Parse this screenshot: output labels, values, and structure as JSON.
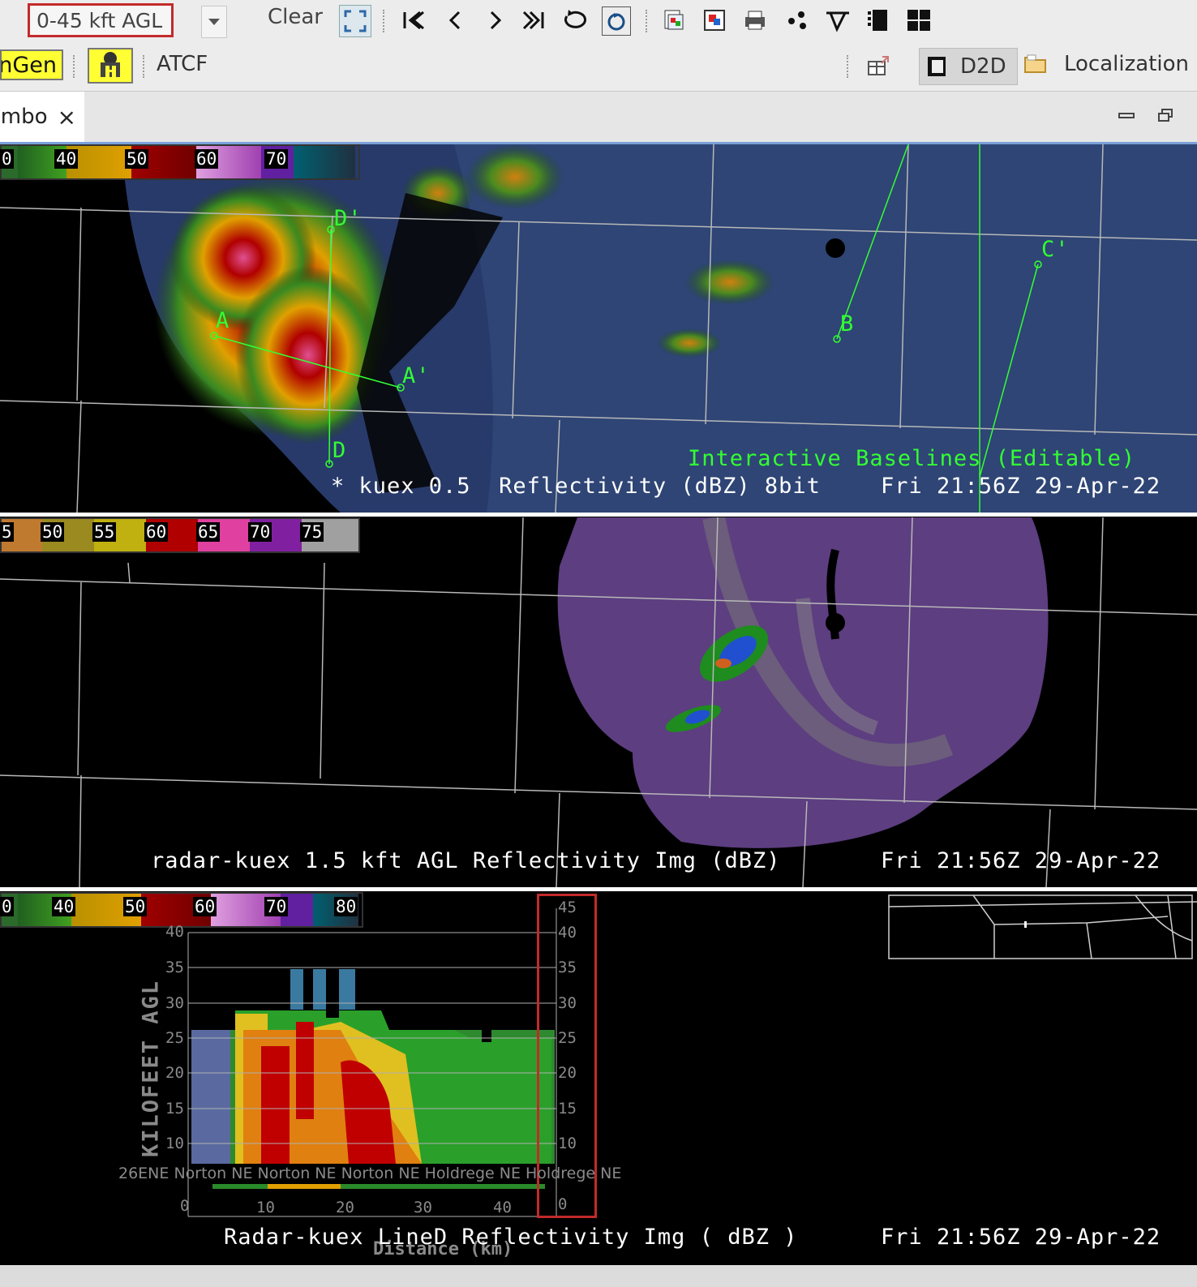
{
  "toolbar": {
    "height_select_value": "0-45 kft AGL",
    "clear_label": "Clear"
  },
  "toolbar2": {
    "ngen_label": "nGen",
    "atcf_label": "ATCF",
    "d2d_label": "D2D",
    "localization_label": "Localization"
  },
  "tabs": {
    "combo_label": "ombo",
    "close_glyph": "×"
  },
  "pane1": {
    "colorbar_labels": [
      "0",
      "40",
      "50",
      "60",
      "70"
    ],
    "baseline_labels": [
      "A",
      "A'",
      "B",
      "C'",
      "D",
      "D'"
    ],
    "editable_label": "Interactive Baselines (Editable)",
    "product_label": "* kuex 0.5  Reflectivity (dBZ) 8bit",
    "time_label": "Fri 21:56Z 29-Apr-22"
  },
  "pane2": {
    "colorbar_labels": [
      "5",
      "50",
      "55",
      "60",
      "65",
      "70",
      "75"
    ],
    "product_label": "radar-kuex 1.5 kft AGL Reflectivity Img (dBZ)",
    "time_label": "Fri 21:56Z 29-Apr-22"
  },
  "pane3": {
    "colorbar_labels": [
      "0",
      "40",
      "50",
      "60",
      "70",
      "80"
    ],
    "y_axis_title": "KILOFEET AGL",
    "y_ticks_left": [
      "40",
      "35",
      "30",
      "25",
      "20",
      "15",
      "10"
    ],
    "y_ticks_right": [
      "45",
      "40",
      "35",
      "30",
      "25",
      "20",
      "15",
      "10",
      "0"
    ],
    "x_ticks": [
      "0",
      "10",
      "20",
      "30",
      "40"
    ],
    "x_axis_title": "Distance (km)",
    "location_labels": "26ENE Norton NE Norton NE Norton NE Holdrege NE Holdrege NE",
    "product_label": "Radar-kuex LineD Reflectivity Img ( dBZ )",
    "time_label": "Fri 21:56Z 29-Apr-22"
  },
  "colors": {
    "baseline_green": "#33ff33",
    "highlight_red": "#c32a2a",
    "hazard_yellow": "#ffff33"
  }
}
